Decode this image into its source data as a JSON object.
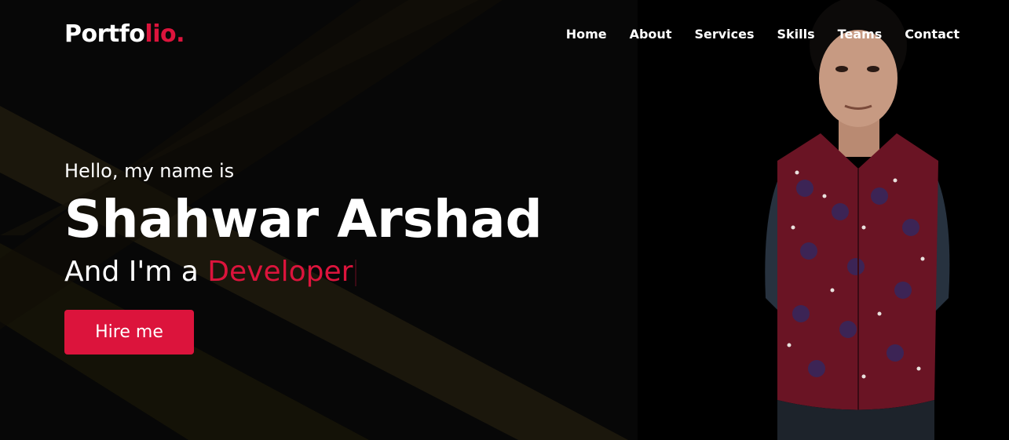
{
  "header": {
    "logo_main": "Portfo",
    "logo_accent": "lio."
  },
  "nav": {
    "items": [
      {
        "label": "Home"
      },
      {
        "label": "About"
      },
      {
        "label": "Services"
      },
      {
        "label": "Skills"
      },
      {
        "label": "Teams"
      },
      {
        "label": "Contact"
      }
    ]
  },
  "hero": {
    "greeting": "Hello, my name is",
    "name": "Shahwar Arshad",
    "role_prefix": "And I'm a ",
    "role_word": "Developer",
    "cta_label": "Hire me"
  },
  "colors": {
    "accent": "#dc143c",
    "background": "#070707",
    "text": "#ffffff",
    "bg_streak": "#2a2410"
  },
  "icons": {
    "typing_caret": "text-caret",
    "portrait": "person-photo"
  }
}
